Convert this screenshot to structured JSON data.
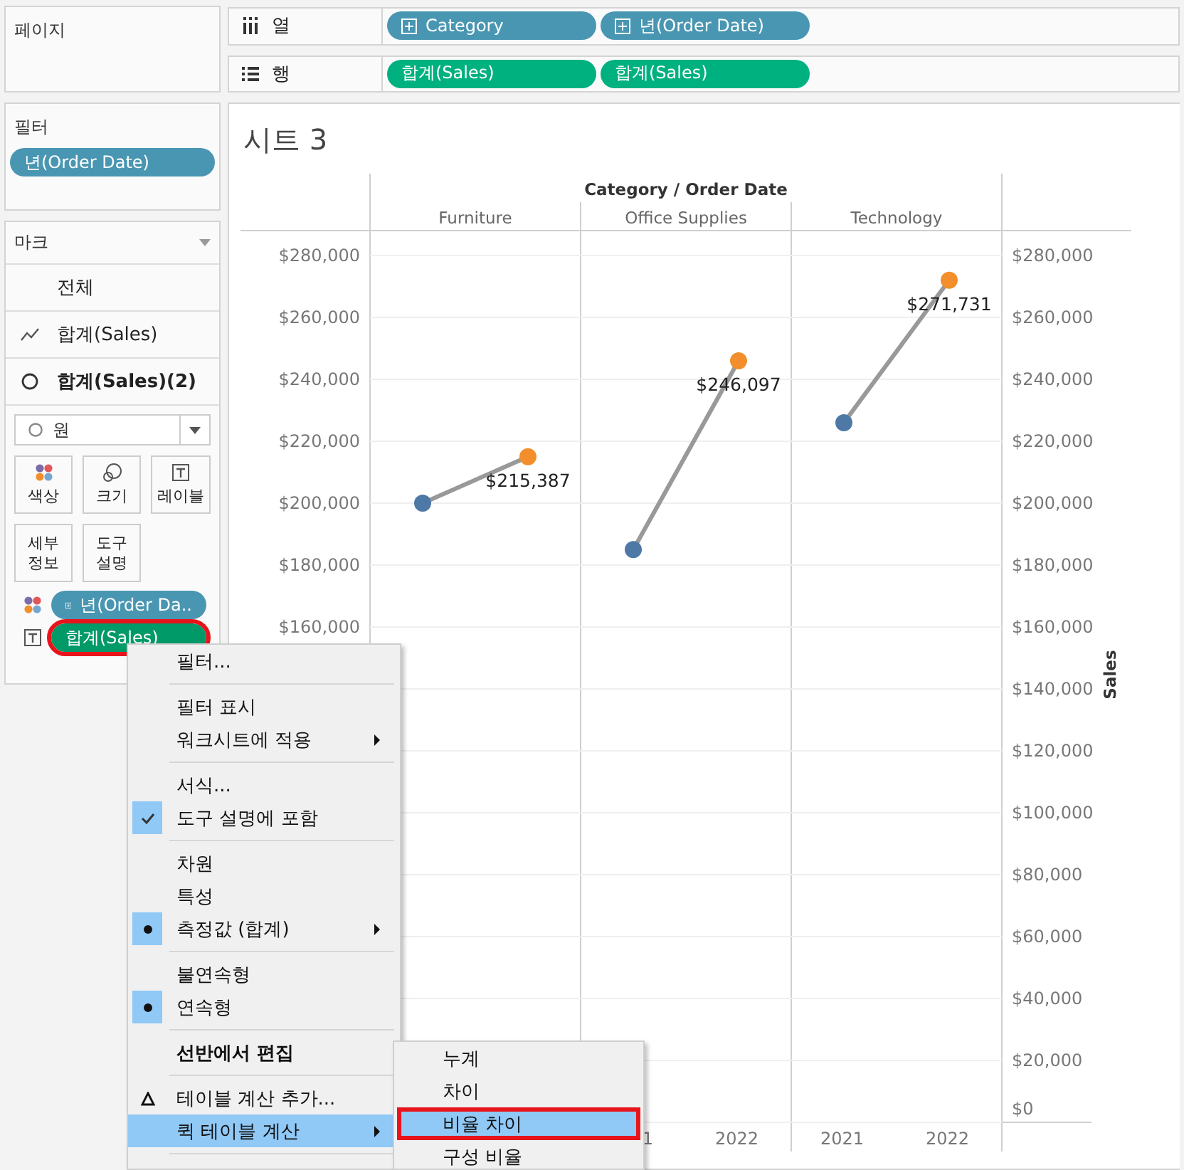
{
  "pages_card": {
    "title": "페이지"
  },
  "filters_card": {
    "title": "필터",
    "pills": [
      {
        "label": "년(Order Date)",
        "kind": "dimension",
        "expandable": false
      }
    ]
  },
  "marks_card": {
    "title": "마크",
    "layers": [
      {
        "label": "전체",
        "selected": false
      },
      {
        "label": "합계(Sales)",
        "selected": false
      },
      {
        "label": "합계(Sales)(2)",
        "selected": true
      }
    ],
    "mark_type": {
      "value": "원"
    },
    "buttons": [
      {
        "label": "색상"
      },
      {
        "label": "크기"
      },
      {
        "label": "레이블"
      },
      {
        "label": "세부 정보"
      },
      {
        "label": "도구 설명"
      }
    ],
    "fields": [
      {
        "label": "년(Order Da..",
        "kind": "dimension",
        "expandable": true,
        "annotated": false
      },
      {
        "label": "합계(Sales)",
        "kind": "measure",
        "expandable": false,
        "annotated": true
      }
    ]
  },
  "columns_shelf": {
    "label": "열",
    "pills": [
      {
        "label": "Category",
        "kind": "dimension",
        "expandable": true
      },
      {
        "label": "년(Order Date)",
        "kind": "dimension",
        "expandable": true
      }
    ]
  },
  "rows_shelf": {
    "label": "행",
    "pills": [
      {
        "label": "합계(Sales)",
        "kind": "measure",
        "expandable": false
      },
      {
        "label": "합계(Sales)",
        "kind": "measure",
        "expandable": false
      }
    ]
  },
  "sheet": {
    "title": "시트 3",
    "header_title": "Category / Order Date",
    "chart_data": {
      "type": "line",
      "ylabel": "Sales",
      "categories": [
        null,
        null,
        null,
        null,
        null,
        null
      ],
      "grid": true,
      "ylim": [
        0,
        280000
      ],
      "yticks": [
        {
          "value": 280000,
          "label": "$280,000"
        },
        {
          "value": 260000,
          "label": "$260,000"
        },
        {
          "value": 240000,
          "label": "$240,000"
        },
        {
          "value": 220000,
          "label": "$220,000"
        },
        {
          "value": 200000,
          "label": "$200,000"
        },
        {
          "value": 180000,
          "label": "$180,000"
        },
        {
          "value": 160000,
          "label": "$160,000"
        }
      ],
      "series": [
        {
          "color": "#999999",
          "marker": "circle",
          "values": [
            200000,
            215000,
            null,
            null,
            null,
            null
          ]
        },
        {
          "color": "#999999",
          "marker": "circle",
          "values": [
            null,
            null,
            185000,
            246000,
            null,
            null
          ]
        },
        {
          "color": "#999999",
          "marker": "circle",
          "values": [
            null,
            null,
            null,
            null,
            226000,
            272000
          ]
        }
      ]
    },
    "right_axis_labels": [
      "$280,000",
      "$260,000",
      "$240,000",
      "$220,000",
      "$200,000",
      "$180,000",
      "$160,000",
      "$140,000",
      "$120,000",
      "$100,000",
      "$80,000",
      "$60,000",
      "$40,000",
      "$20,000",
      "$0"
    ],
    "panes": [
      {
        "category": "Furniture",
        "value_label": "$215,387"
      },
      {
        "category": "Office Supplies",
        "value_label": "$246,097",
        "year_labels": [
          "1",
          "2022"
        ]
      },
      {
        "category": "Technology",
        "value_label": "$271,731",
        "year_labels": [
          "2021",
          "2022"
        ]
      }
    ]
  },
  "context_menu": {
    "items": [
      {
        "kind": "command",
        "label": "필터...",
        "submenu": false,
        "bold": false,
        "highlighted": false
      },
      {
        "kind": "separator"
      },
      {
        "kind": "command",
        "label": "필터 표시",
        "submenu": false,
        "bold": false,
        "highlighted": false
      },
      {
        "kind": "command",
        "label": "워크시트에 적용",
        "submenu": true,
        "bold": false,
        "highlighted": false
      },
      {
        "kind": "separator"
      },
      {
        "kind": "command",
        "label": "서식...",
        "submenu": false,
        "bold": false,
        "highlighted": false
      },
      {
        "kind": "check",
        "label": "도구 설명에 포함",
        "checked": true,
        "submenu": false,
        "bold": false,
        "highlighted": false
      },
      {
        "kind": "separator"
      },
      {
        "kind": "radio",
        "label": "차원",
        "checked": false,
        "submenu": false,
        "bold": false,
        "highlighted": false
      },
      {
        "kind": "radio",
        "label": "특성",
        "checked": false,
        "submenu": false,
        "bold": false,
        "highlighted": false
      },
      {
        "kind": "radio",
        "label": "측정값 (합계)",
        "checked": true,
        "submenu": true,
        "bold": false,
        "highlighted": false
      },
      {
        "kind": "separator"
      },
      {
        "kind": "radio",
        "label": "불연속형",
        "checked": false,
        "submenu": false,
        "bold": false,
        "highlighted": false
      },
      {
        "kind": "radio",
        "label": "연속형",
        "checked": true,
        "submenu": false,
        "bold": false,
        "highlighted": false
      },
      {
        "kind": "separator"
      },
      {
        "kind": "command",
        "label": "선반에서 편집",
        "submenu": false,
        "bold": true,
        "highlighted": false
      },
      {
        "kind": "separator"
      },
      {
        "kind": "calculation",
        "label": "테이블 계산 추가...",
        "submenu": false,
        "bold": false,
        "highlighted": false
      },
      {
        "kind": "command",
        "label": "퀵 테이블 계산",
        "submenu": true,
        "bold": false,
        "highlighted": true
      },
      {
        "kind": "separator"
      }
    ]
  },
  "submenu": {
    "items": [
      {
        "label": "누계",
        "highlighted": false,
        "annotated": false
      },
      {
        "label": "차이",
        "highlighted": false,
        "annotated": false
      },
      {
        "label": "비율 차이",
        "highlighted": true,
        "annotated": true
      },
      {
        "label": "구성 비율",
        "highlighted": false,
        "annotated": false
      }
    ]
  }
}
